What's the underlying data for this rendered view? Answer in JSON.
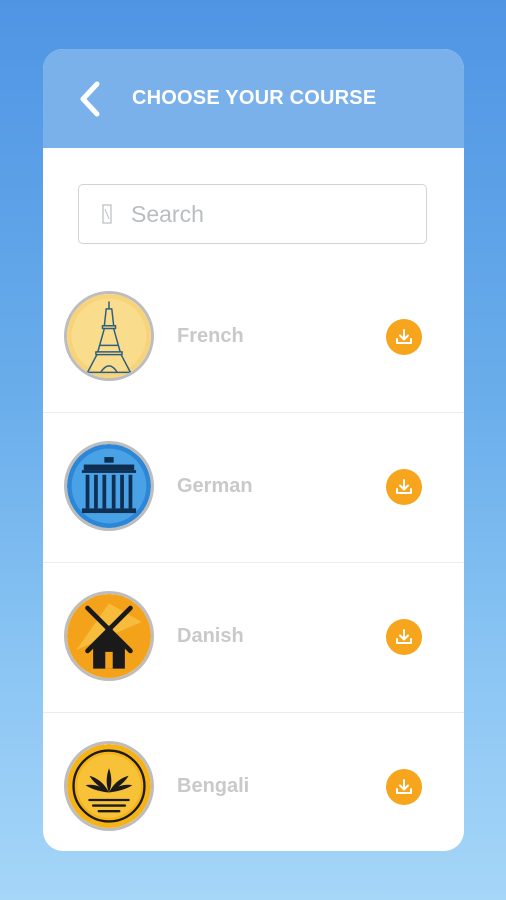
{
  "header": {
    "title": "CHOOSE YOUR COURSE",
    "back_icon": "chevron-left-icon"
  },
  "search": {
    "placeholder": "Search",
    "value": "",
    "icon": "search-icon"
  },
  "courses": [
    {
      "label": "French",
      "icon": "eiffel-tower-icon",
      "badge_color": "#f7d37a",
      "action_icon": "download-icon"
    },
    {
      "label": "German",
      "icon": "brandenburg-gate-icon",
      "badge_color": "#2e86d6",
      "action_icon": "download-icon"
    },
    {
      "label": "Danish",
      "icon": "windmill-icon",
      "badge_color": "#f4a21a",
      "action_icon": "download-icon"
    },
    {
      "label": "Bengali",
      "icon": "water-lily-emblem-icon",
      "badge_color": "#f6b318",
      "action_icon": "download-icon"
    }
  ],
  "colors": {
    "header_bg": "#7ab1eb",
    "accent": "#f6a51c",
    "course_text": "#c9c9c9"
  }
}
